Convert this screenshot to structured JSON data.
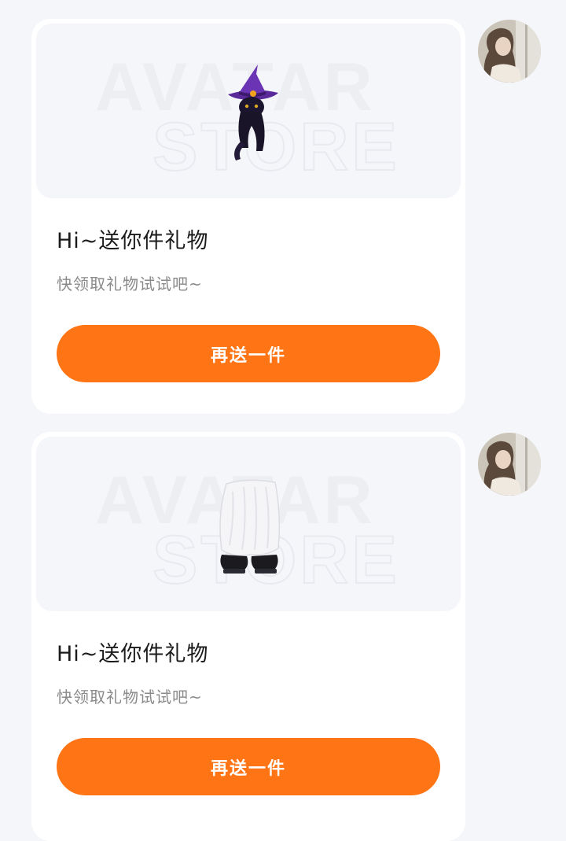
{
  "messages": [
    {
      "watermark": {
        "line1": "AVATAR",
        "line2": "STORE"
      },
      "item_icon": "witch-hat-cat-icon",
      "title": "Hi~送你件礼物",
      "subtitle": "快领取礼物试试吧~",
      "button_label": "再送一件"
    },
    {
      "watermark": {
        "line1": "AVATAR",
        "line2": "STORE"
      },
      "item_icon": "fluffy-boots-icon",
      "title": "Hi~送你件礼物",
      "subtitle": "快领取礼物试试吧~",
      "button_label": "再送一件"
    }
  ],
  "colors": {
    "page_background": "#f4f6f9",
    "card_background": "#ffffff",
    "preview_background": "#f4f6fa",
    "button": "#ff7414",
    "button_text": "#ffffff",
    "title": "#1b1b1b",
    "subtitle": "#8a8a8a"
  }
}
